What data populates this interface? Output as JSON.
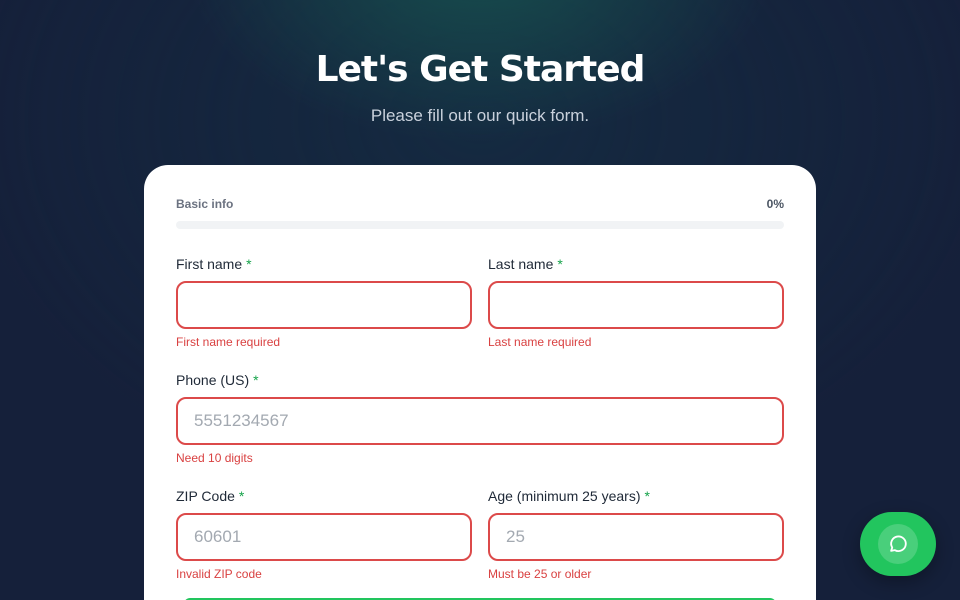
{
  "hero": {
    "title": "Let's Get Started",
    "subtitle": "Please fill out our quick form."
  },
  "progress": {
    "section": "Basic info",
    "percent_label": "0%",
    "value": 0
  },
  "form": {
    "first_name": {
      "label": "First name",
      "required_mark": "*",
      "value": "",
      "placeholder": "",
      "error": "First name required"
    },
    "last_name": {
      "label": "Last name",
      "required_mark": "*",
      "value": "",
      "placeholder": "",
      "error": "Last name required"
    },
    "phone": {
      "label": "Phone (US)",
      "required_mark": "*",
      "value": "",
      "placeholder": "5551234567",
      "error": "Need 10 digits"
    },
    "zip": {
      "label": "ZIP Code",
      "required_mark": "*",
      "value": "",
      "placeholder": "60601",
      "error": "Invalid ZIP code"
    },
    "age": {
      "label": "Age (minimum 25 years)",
      "required_mark": "*",
      "value": "",
      "placeholder": "25",
      "error": "Must be 25 or older"
    }
  },
  "chat": {
    "icon": "chat-bubble-icon"
  },
  "colors": {
    "accent": "#22c55e",
    "error": "#d94141",
    "background": "#15203a"
  }
}
